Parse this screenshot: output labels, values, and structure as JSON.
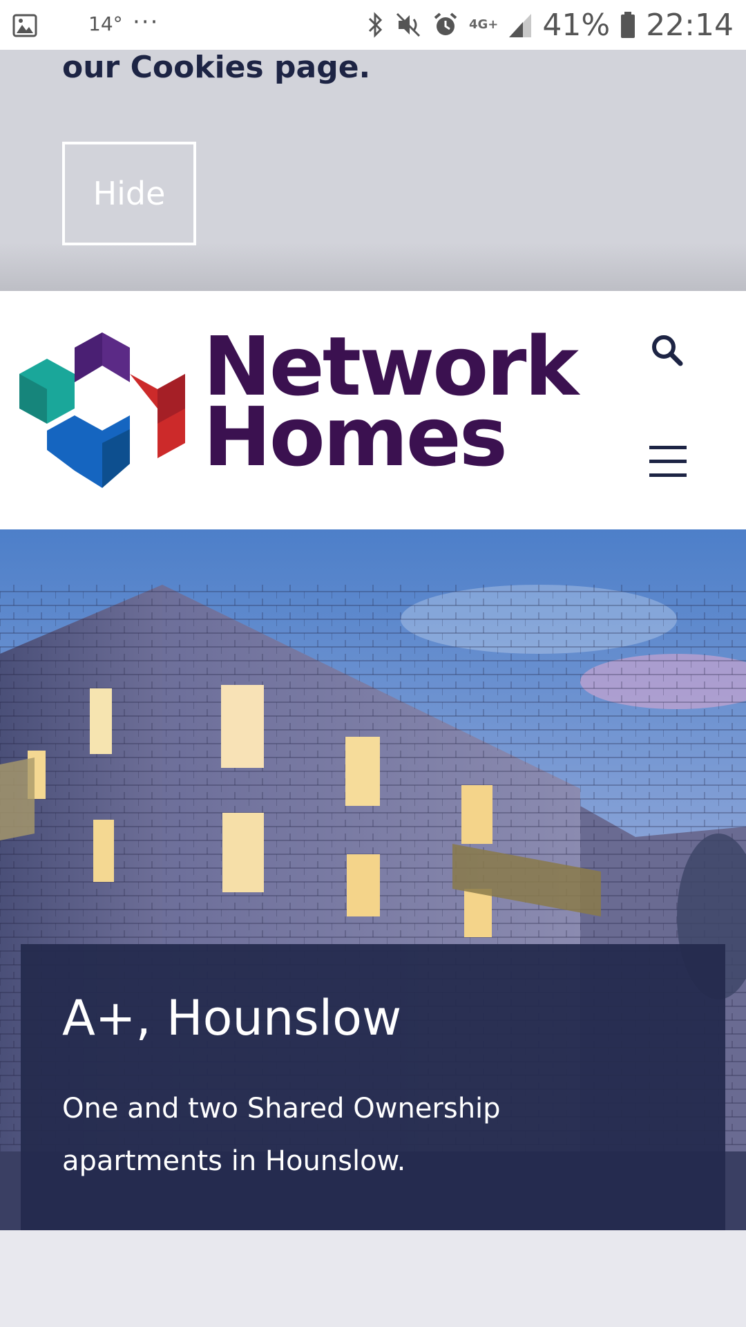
{
  "status_bar": {
    "temperature": "14°",
    "more": "···",
    "network": "4G+",
    "battery": "41%",
    "time": "22:14"
  },
  "cookie_banner": {
    "text": "our Cookies page.",
    "hide_label": "Hide"
  },
  "header": {
    "logo_line1": "Network",
    "logo_line2": "Homes"
  },
  "hero": {
    "title": "A+, Hounslow",
    "description": "One and two Shared Ownership apartments in Hounslow."
  },
  "colors": {
    "brand_purple": "#3b1150",
    "banner_bg": "#d2d3da",
    "hero_card": "#242b4e"
  }
}
